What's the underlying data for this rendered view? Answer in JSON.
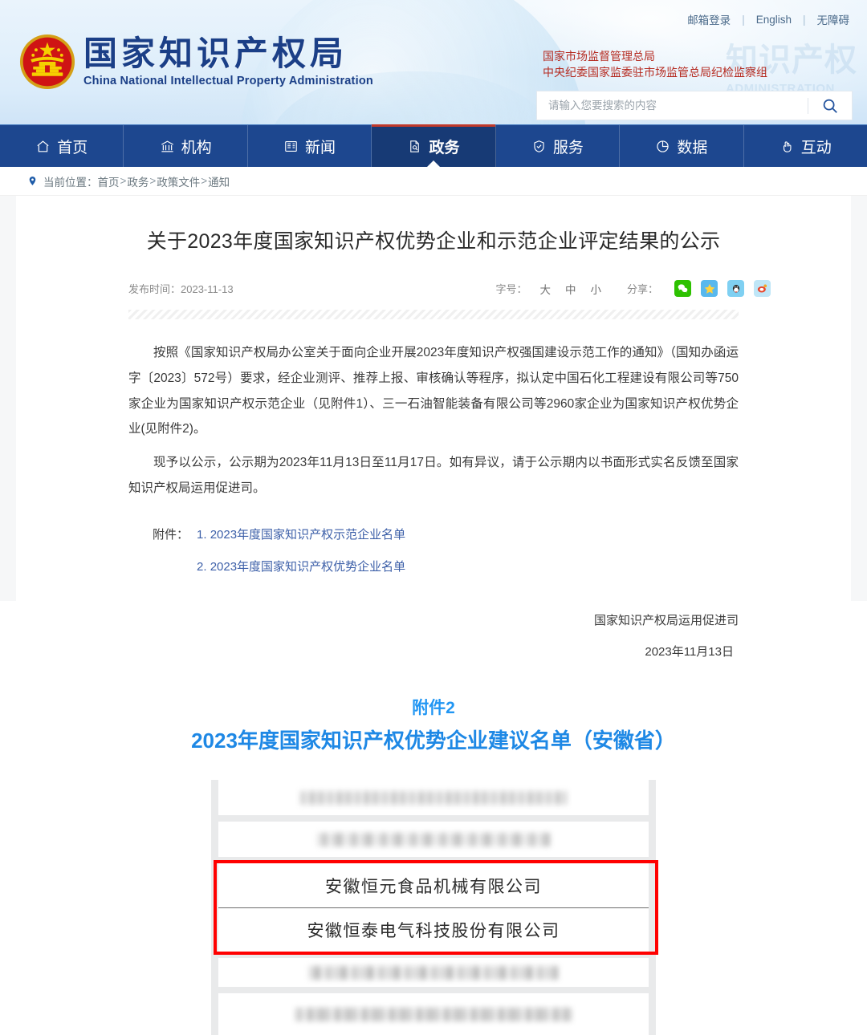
{
  "header": {
    "logo_cn": "国家知识产权局",
    "logo_en": "China National Intellectual Property Administration",
    "emblem_name": "national-emblem",
    "ghost_text": "知识产权",
    "ghost_sub": "ADMINISTRATION",
    "top_links": [
      {
        "label": "邮箱登录",
        "name": "mail-login-link"
      },
      {
        "label": "English",
        "name": "english-link"
      },
      {
        "label": "无障碍",
        "name": "accessibility-link"
      }
    ],
    "separator": "|",
    "red_lines": [
      "国家市场监督管理总局",
      "中央纪委国家监委驻市场监管总局纪检监察组"
    ],
    "search": {
      "placeholder": "请输入您要搜索的内容",
      "value": "",
      "icon": "search-icon"
    }
  },
  "nav": {
    "items": [
      {
        "label": "首页",
        "icon": "home-icon",
        "active": false
      },
      {
        "label": "机构",
        "icon": "bank-icon",
        "active": false
      },
      {
        "label": "新闻",
        "icon": "newspaper-icon",
        "active": false
      },
      {
        "label": "政务",
        "icon": "document-icon",
        "active": true
      },
      {
        "label": "服务",
        "icon": "shield-icon",
        "active": false
      },
      {
        "label": "数据",
        "icon": "piechart-icon",
        "active": false
      },
      {
        "label": "互动",
        "icon": "hand-icon",
        "active": false
      }
    ]
  },
  "breadcrumb": {
    "icon": "location-pin-icon",
    "label": "当前位置：",
    "items": [
      "首页",
      "政务",
      "政策文件",
      "通知"
    ],
    "separator": ">"
  },
  "article": {
    "title": "关于2023年度国家知识产权优势企业和示范企业评定结果的公示",
    "publish_label": "发布时间：",
    "publish_date": "2023-11-13",
    "fontsize_label": "字号：",
    "fontsize_options": [
      "大",
      "中",
      "小"
    ],
    "share_label": "分享：",
    "share_icons": [
      {
        "name": "wechat-share-icon",
        "glyph": "💬",
        "color": "#2dc100"
      },
      {
        "name": "favorite-share-icon",
        "glyph": "★",
        "color": "#58b8ee"
      },
      {
        "name": "qq-share-icon",
        "glyph": "🐧",
        "color": "#7fd0f2"
      },
      {
        "name": "weibo-share-icon",
        "glyph": "◎",
        "color": "#bfe6f7"
      }
    ],
    "paragraphs": [
      "按照《国家知识产权局办公室关于面向企业开展2023年度知识产权强国建设示范工作的通知》（国知办函运字〔2023〕572号）要求，经企业测评、推荐上报、审核确认等程序，拟认定中国石化工程建设有限公司等750家企业为国家知识产权示范企业（见附件1）、三一石油智能装备有限公司等2960家企业为国家知识产权优势企业(见附件2)。",
      "现予以公示，公示期为2023年11月13日至11月17日。如有异议，请于公示期内以书面形式实名反馈至国家知识产权局运用促进司。"
    ],
    "attachments_label": "附件：",
    "attachments": [
      "1. 2023年度国家知识产权示范企业名单",
      "2. 2023年度国家知识产权优势企业名单"
    ],
    "signature_org": "国家知识产权局运用促进司",
    "signature_date": "2023年11月13日"
  },
  "attachment2": {
    "subtitle": "附件2",
    "title": "2023年度国家知识产权优势企业建议名单（安徽省）",
    "accent_color": "#1e88e5",
    "rows": [
      {
        "text": "",
        "blurred": true,
        "variant": "v1",
        "highlighted": false
      },
      {
        "text": "",
        "blurred": true,
        "variant": "v2",
        "highlighted": false
      },
      {
        "text": "安徽恒元食品机械有限公司",
        "blurred": false,
        "variant": "",
        "highlighted": true
      },
      {
        "text": "安徽恒泰电气科技股份有限公司",
        "blurred": false,
        "variant": "",
        "highlighted": true
      },
      {
        "text": "",
        "blurred": true,
        "variant": "v3",
        "highlighted": false
      },
      {
        "text": "",
        "blurred": true,
        "variant": "v4",
        "highlighted": false
      }
    ],
    "highlight_box_color": "#ff0000"
  }
}
